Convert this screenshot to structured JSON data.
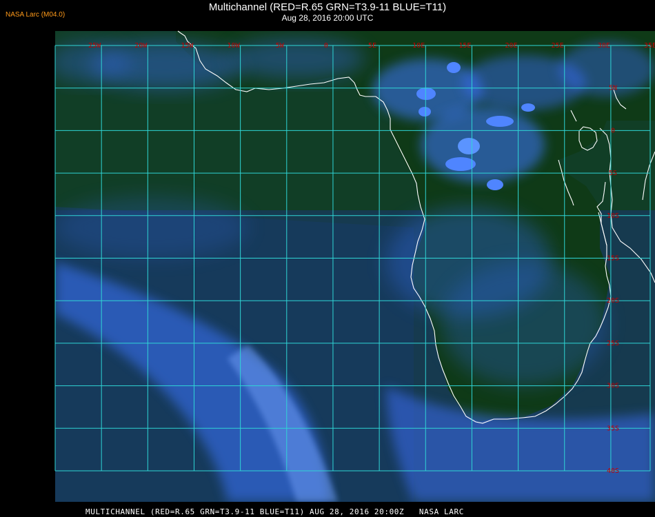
{
  "header": {
    "source_label": "NASA Larc (M04.0)",
    "title": "Multichannel (RED=R.65 GRN=T3.9-11 BLUE=T11)",
    "subtitle": "Aug 28, 2016 20:00 UTC"
  },
  "map": {
    "lon_labels": [
      "25W",
      "20W",
      "15W",
      "10W",
      "5W",
      "0",
      "5E",
      "10E",
      "15E",
      "20E",
      "25E",
      "30E",
      "35E"
    ],
    "lat_labels": [
      "5N",
      "0",
      "5S",
      "10S",
      "15S",
      "20S",
      "25S",
      "30S",
      "35S",
      "40S"
    ],
    "colors": {
      "grid": "#2fd6d6",
      "grid_label": "#c40000",
      "coastline": "#ffffff",
      "ocean": "#13365a",
      "land": "#0f3a16",
      "cloud": "#3d78ff"
    }
  },
  "footer": {
    "caption": "MULTICHANNEL (RED=R.65 GRN=T3.9-11 BLUE=T11) AUG 28, 2016 20:00Z   NASA LARC"
  }
}
